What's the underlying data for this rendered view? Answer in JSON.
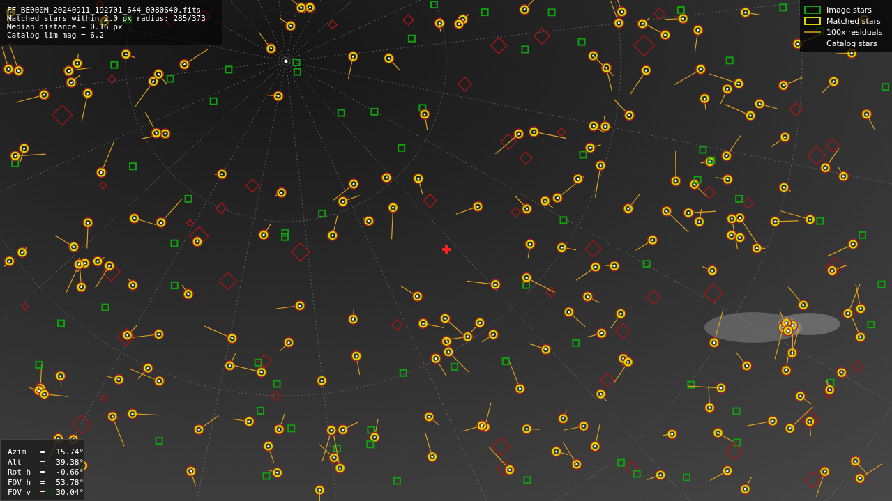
{
  "header": {
    "lines": [
      "FF_BE000M_20240911_192701_644_0080640.fits",
      "Matched stars within 2.0 px radius: 285/373",
      "Median distance = 0.16 px",
      "Catalog lim mag = 6.2"
    ]
  },
  "legend": [
    {
      "kind": "image",
      "label": "Image stars"
    },
    {
      "kind": "matched",
      "label": "Matched stars"
    },
    {
      "kind": "residual",
      "label": "100x residuals"
    },
    {
      "kind": "catalog",
      "label": "Catalog stars"
    }
  ],
  "pointing": [
    {
      "label": "Azim",
      "sep": "=",
      "value": "15.74°"
    },
    {
      "label": "Alt",
      "sep": "=",
      "value": "39.38°"
    },
    {
      "label": "Rot h",
      "sep": "=",
      "value": "-0.66°"
    },
    {
      "label": "FOV h",
      "sep": "=",
      "value": "53.78°"
    },
    {
      "label": "FOV v",
      "sep": "=",
      "value": "30.04°"
    }
  ]
}
